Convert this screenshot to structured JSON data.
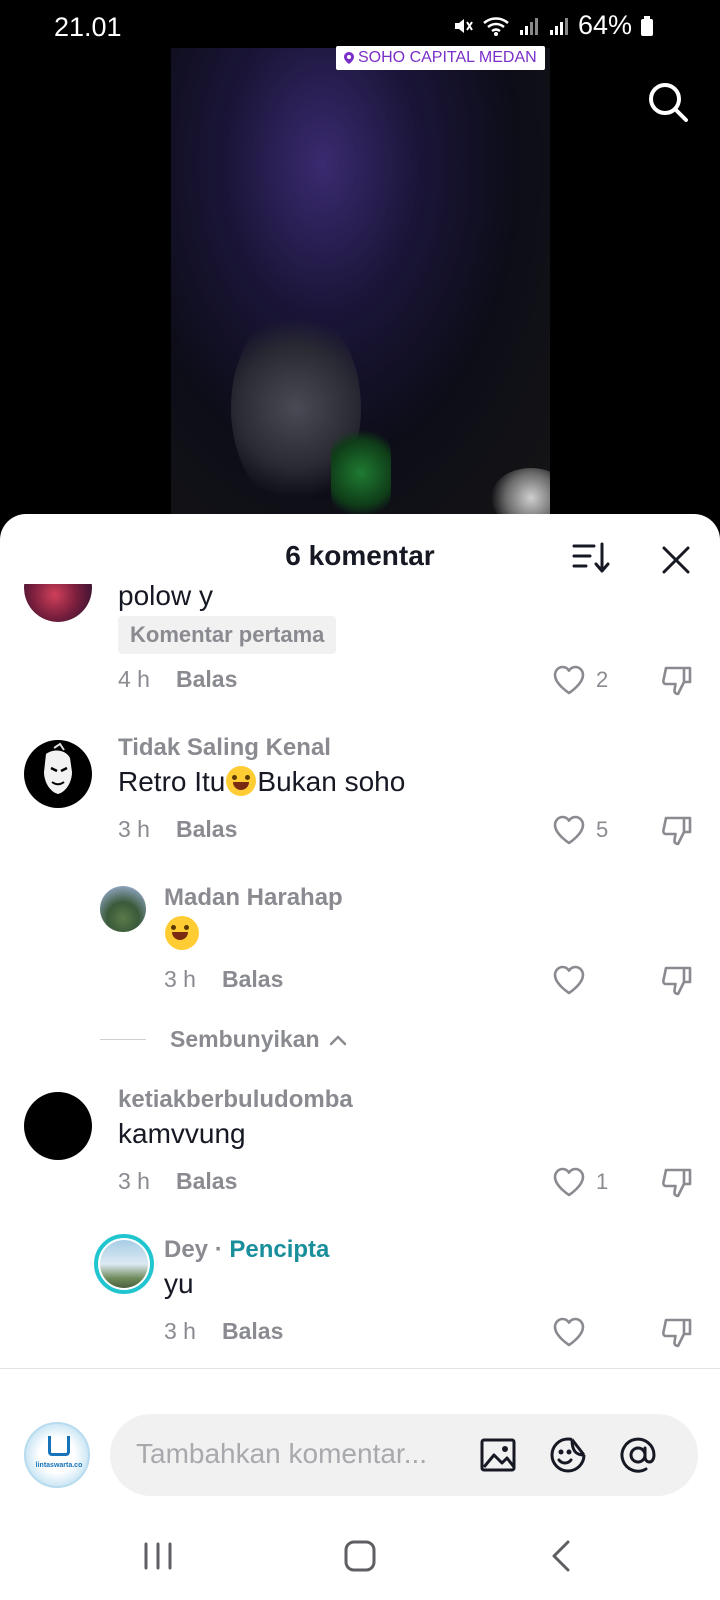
{
  "status_bar": {
    "time": "21.01",
    "battery": "64%"
  },
  "video": {
    "location_tag": "SOHO CAPITAL MEDAN"
  },
  "sheet": {
    "title": "6 komentar"
  },
  "comments": [
    {
      "text": "polow y",
      "badge": "Komentar pertama",
      "time": "4 h",
      "reply_label": "Balas",
      "likes": "2"
    },
    {
      "name": "Tidak Saling Kenal",
      "text_before": "Retro Itu",
      "text_after": "Bukan soho",
      "time": "3 h",
      "reply_label": "Balas",
      "likes": "5"
    },
    {
      "name": "Madan Harahap",
      "time": "3 h",
      "reply_label": "Balas"
    },
    {
      "name": "ketiakberbuludomba",
      "text": "kamvvung",
      "time": "3 h",
      "reply_label": "Balas",
      "likes": "1"
    },
    {
      "name": "Dey",
      "separator": " · ",
      "creator_label": "Pencipta",
      "text": "yu",
      "time": "3 h",
      "reply_label": "Balas"
    }
  ],
  "hide_replies_label": "Sembunyikan",
  "input": {
    "placeholder": "Tambahkan komentar...",
    "avatar_text": "lintaswarta.co"
  },
  "colors": {
    "creator_accent": "#1a8f9c",
    "location_tag_text": "#7a2fc9",
    "secondary_text": "#8a8b91"
  }
}
